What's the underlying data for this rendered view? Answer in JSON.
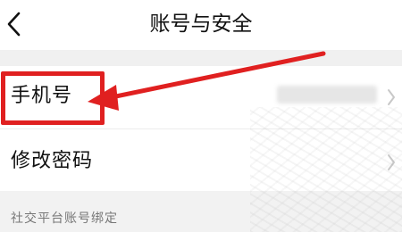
{
  "header": {
    "title": "账号与安全"
  },
  "rows": [
    {
      "label": "手机号"
    },
    {
      "label": "修改密码"
    }
  ],
  "section": {
    "label": "社交平台账号绑定"
  },
  "colors": {
    "highlight": "#e02020",
    "background": "#f2f2f2"
  },
  "icons": {
    "back": "chevron-left-icon",
    "row_chevron": "chevron-right-icon"
  }
}
